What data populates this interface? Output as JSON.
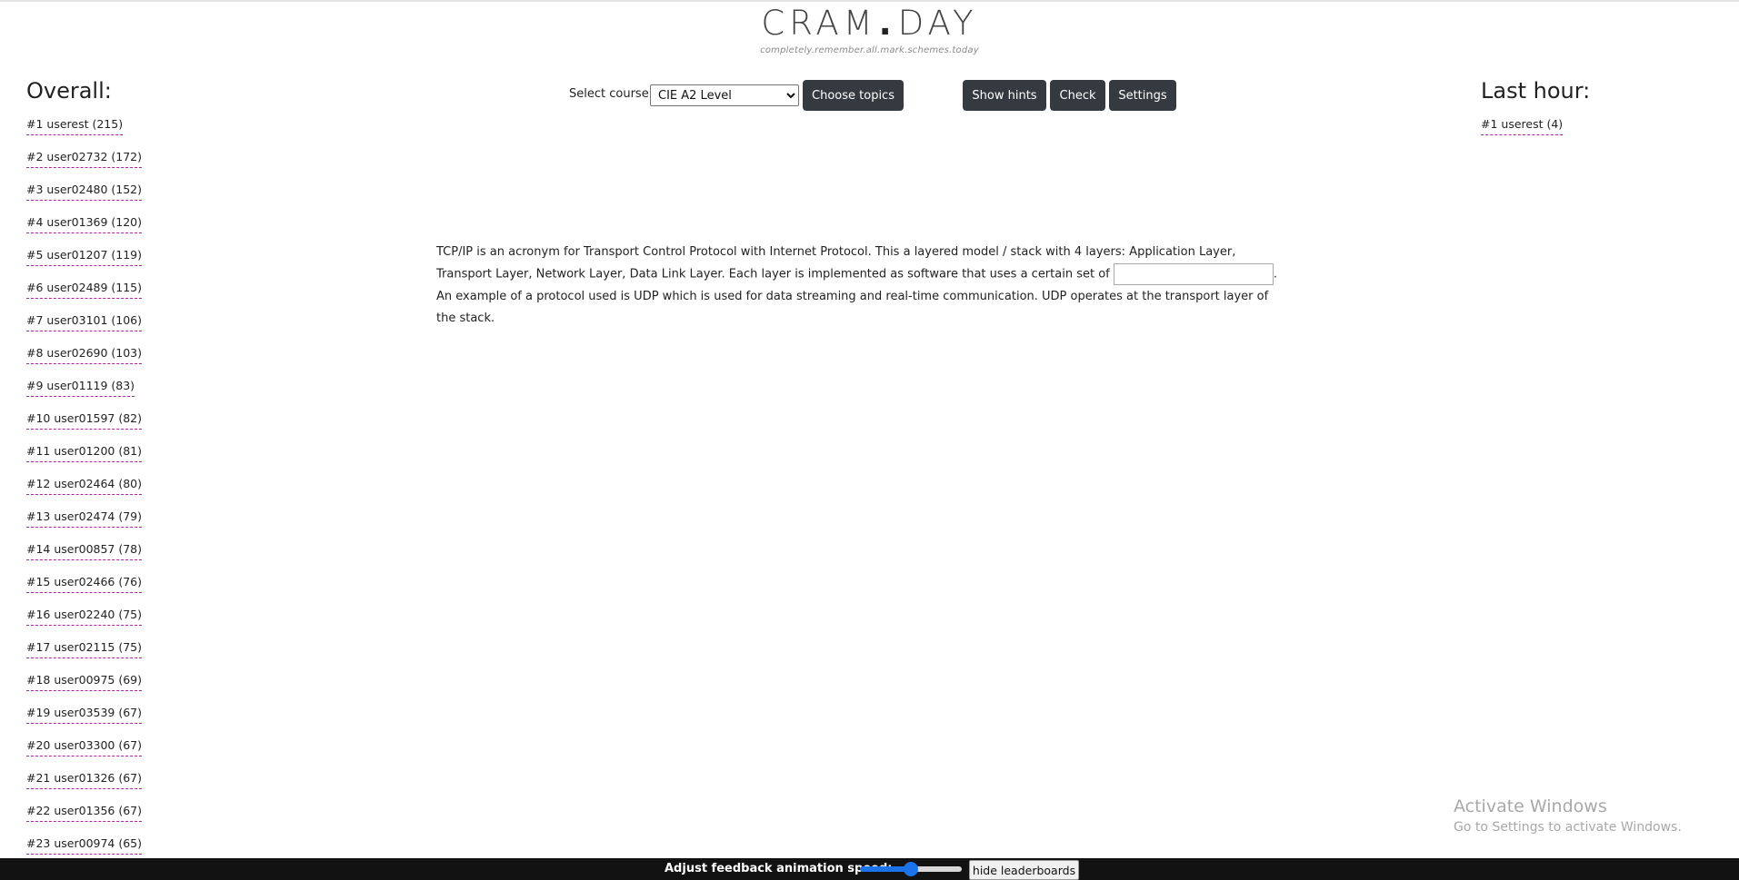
{
  "header": {
    "logo_left": "CRAM",
    "logo_dot": ".",
    "logo_right": "DAY",
    "tagline": "completely.remember.all.mark.schemes.today"
  },
  "overall": {
    "title": "Overall:",
    "entries": [
      "#1 userest (215)",
      "#2 user02732 (172)",
      "#3 user02480 (152)",
      "#4 user01369 (120)",
      "#5 user01207 (119)",
      "#6 user02489 (115)",
      "#7 user03101 (106)",
      "#8 user02690 (103)",
      "#9 user01119 (83)",
      "#10 user01597 (82)",
      "#11 user01200 (81)",
      "#12 user02464 (80)",
      "#13 user02474 (79)",
      "#14 user00857 (78)",
      "#15 user02466 (76)",
      "#16 user02240 (75)",
      "#17 user02115 (75)",
      "#18 user00975 (69)",
      "#19 user03539 (67)",
      "#20 user03300 (67)",
      "#21 user01326 (67)",
      "#22 user01356 (67)",
      "#23 user00974 (65)"
    ]
  },
  "last_hour": {
    "title": "Last hour:",
    "entries": [
      "#1 userest (4)"
    ]
  },
  "controls": {
    "select_label": "Select course:",
    "course_selected": "CIE A2 Level",
    "choose_topics": "Choose topics",
    "show_hints": "Show hints",
    "check": "Check",
    "settings": "Settings"
  },
  "question": {
    "part1": "TCP/IP is an acronym for Transport Control Protocol with Internet Protocol. This a layered model / stack with 4 layers: Application Layer, Transport Layer, Network Layer, Data Link Layer. Each layer is implemented as software that uses a certain set of ",
    "blank_value": "",
    "part2": ". An example of a protocol used is UDP which is used for data streaming and real-time communication. UDP operates at the transport layer of the stack."
  },
  "watermark": {
    "title": "Activate Windows",
    "subtitle": "Go to Settings to activate Windows."
  },
  "bottom_bar": {
    "speed_label": "Adjust feedback animation speed:",
    "speed_value": 0.5,
    "hide_leaderboards": "hide leaderboards"
  },
  "colors": {
    "button_bg": "#343a40",
    "leaderboard_underline": "#b3229b",
    "bottom_bar_bg": "#121212",
    "slider_accent": "#1a73e8"
  }
}
